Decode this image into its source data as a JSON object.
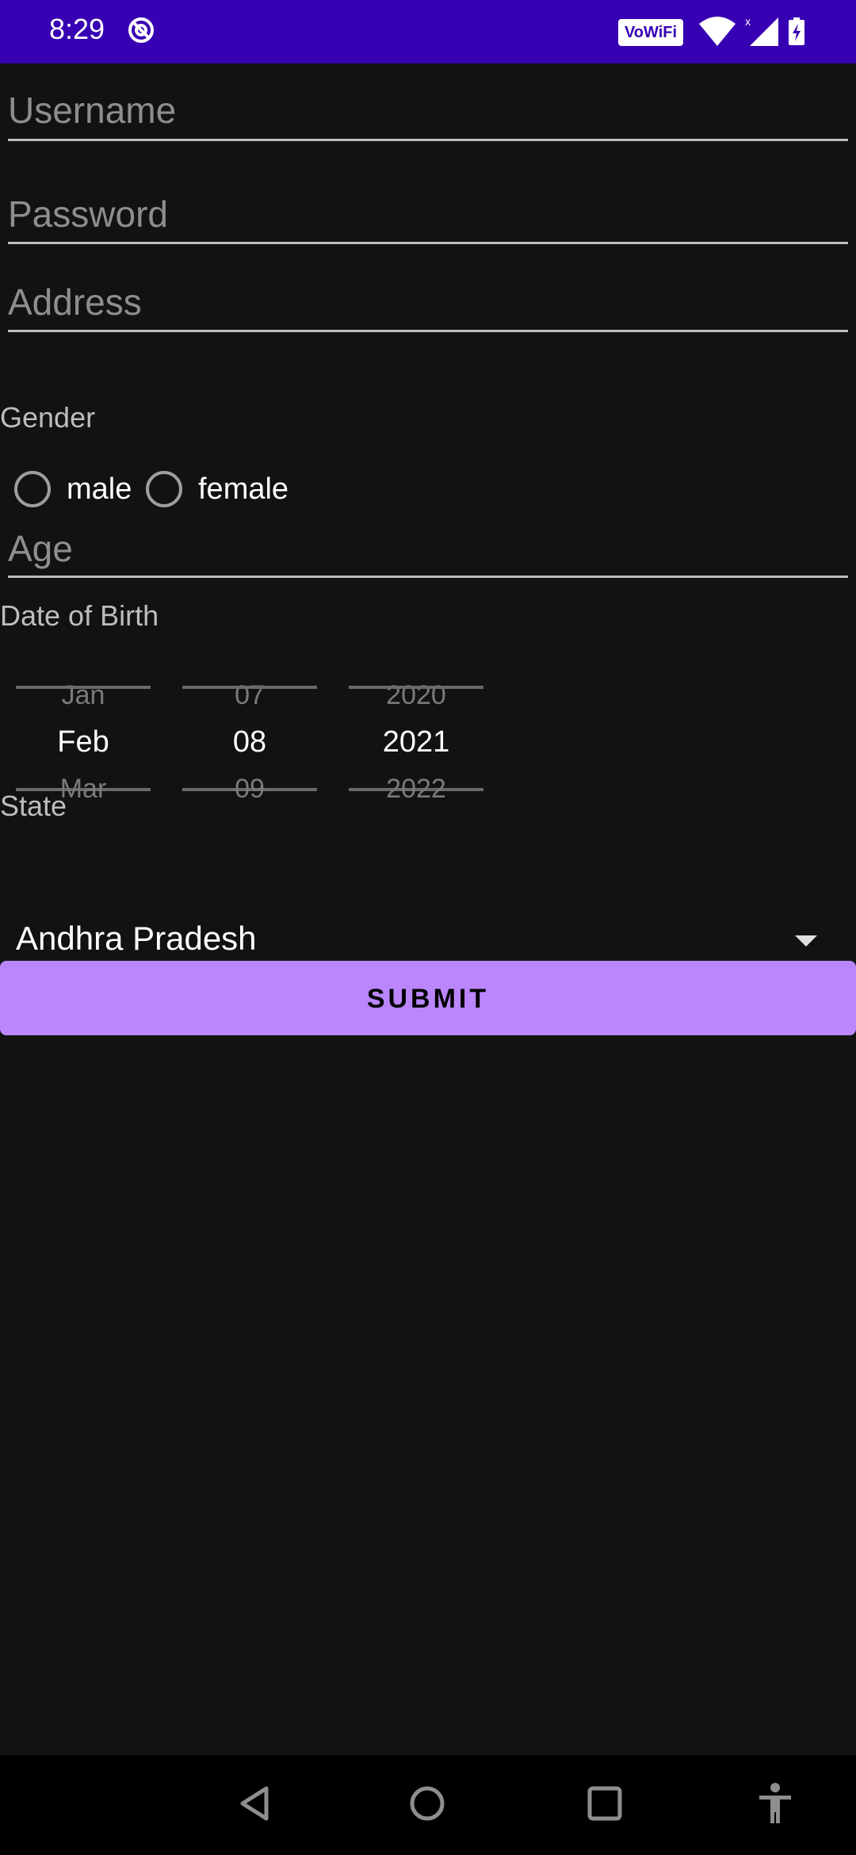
{
  "status_bar": {
    "time": "8:29",
    "vowifi": "VoWiFi",
    "icons": [
      "dnd-icon",
      "wifi-icon",
      "signal-icon",
      "battery-icon"
    ],
    "background": "#3700b3"
  },
  "form": {
    "username_hint": "Username",
    "password_hint": "Password",
    "address_hint": "Address",
    "gender_label": "Gender",
    "gender_options": [
      "male",
      "female"
    ],
    "age_hint": "Age",
    "dob_label": "Date of Birth",
    "date_picker": {
      "month": {
        "prev": "Jan",
        "selected": "Feb",
        "next": "Mar"
      },
      "day": {
        "prev": "07",
        "selected": "08",
        "next": "09"
      },
      "year": {
        "prev": "2020",
        "selected": "2021",
        "next": "2022"
      }
    },
    "state_label": "State",
    "state_value": "Andhra Pradesh",
    "submit_label": "SUBMIT"
  },
  "colors": {
    "background": "#121212",
    "accent": "#bb86fc",
    "status_bar": "#3700b3"
  },
  "nav_bar": {
    "icons": [
      "back-icon",
      "home-icon",
      "recents-icon",
      "accessibility-icon"
    ]
  }
}
